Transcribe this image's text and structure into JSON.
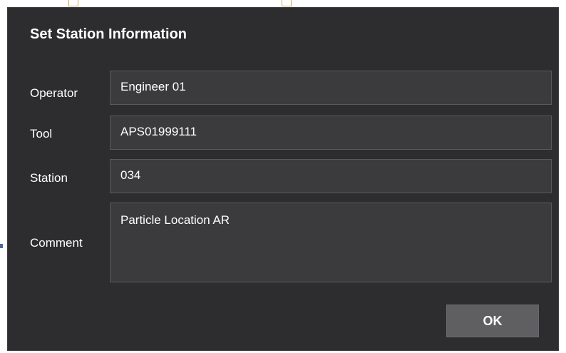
{
  "dialog": {
    "title": "Set Station Information",
    "fields": {
      "operator": {
        "label": "Operator",
        "value": "Engineer 01"
      },
      "tool": {
        "label": "Tool",
        "value": "APS01999111"
      },
      "station": {
        "label": "Station",
        "value": "034"
      },
      "comment": {
        "label": "Comment",
        "value": "Particle Location AR"
      }
    },
    "ok_label": "OK"
  },
  "colors": {
    "dialog_bg": "#2d2d30",
    "field_bg": "#3b3b3d",
    "button_bg": "#5f5f61",
    "text": "#ffffff"
  }
}
